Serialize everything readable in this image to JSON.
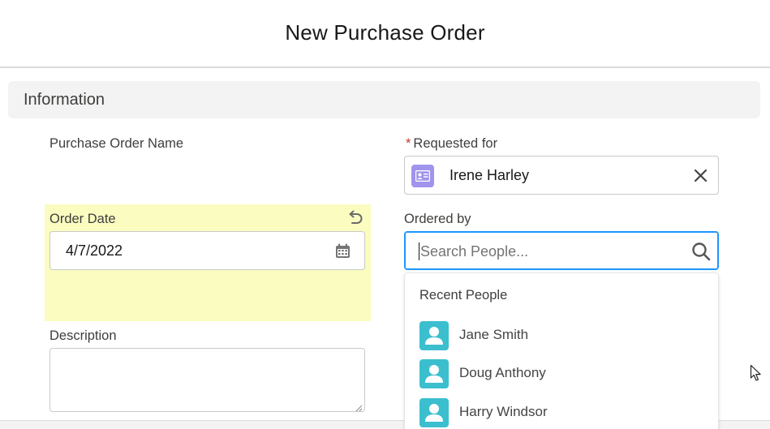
{
  "modal": {
    "title": "New Purchase Order"
  },
  "section": {
    "title": "Information"
  },
  "fields": {
    "po_name": {
      "label": "Purchase Order Name"
    },
    "requested_for": {
      "required_mark": "*",
      "label": "Requested for",
      "value": "Irene Harley"
    },
    "order_date": {
      "label": "Order Date",
      "value": "4/7/2022"
    },
    "ordered_by": {
      "label": "Ordered by",
      "placeholder": "Search People..."
    },
    "description": {
      "label": "Description",
      "value": ""
    }
  },
  "dropdown": {
    "heading": "Recent People",
    "people": [
      {
        "name": "Jane Smith"
      },
      {
        "name": "Doug Anthony"
      },
      {
        "name": "Harry Windsor"
      }
    ]
  },
  "icons": {
    "undo": "undo-icon",
    "calendar": "calendar-icon",
    "contact": "contact-card-icon",
    "clear": "close-icon",
    "search": "search-icon",
    "person": "person-icon"
  },
  "colors": {
    "edited_highlight": "#fafcc0",
    "contact_badge": "#a094ed",
    "person_avatar": "#3bbfcf",
    "focus_border": "#1b96ff",
    "required": "#c23934"
  }
}
